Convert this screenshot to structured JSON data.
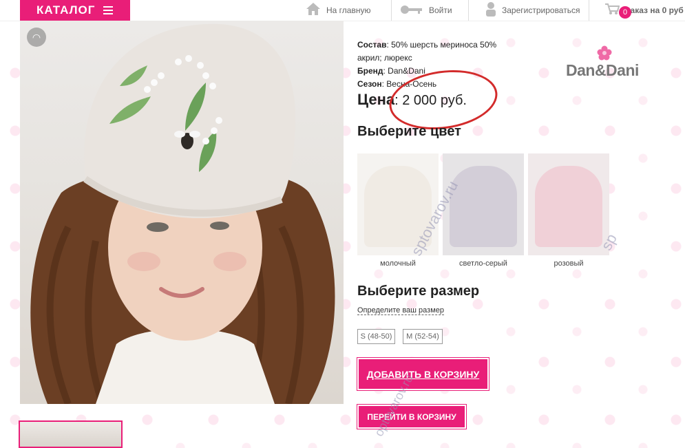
{
  "header": {
    "catalog_label": "КАТАЛОГ",
    "nav": {
      "home": "На главную",
      "login": "Войти",
      "register": "Зарегистрироваться",
      "cart_summary": "Заказ на 0 руб",
      "cart_count": "0"
    }
  },
  "product": {
    "composition_label": "Состав",
    "composition_value": ": 50% шерсть мериноса 50% акрил; люрекс",
    "brand_label": "Бренд",
    "brand_value": ": Dan&Dani",
    "season_label": "Сезон",
    "season_value": ": Весна-Осень",
    "price_label": "Цена",
    "price_value": ": 2 000 руб.",
    "brand_logo_text": "Dan&Dani"
  },
  "color_section": {
    "title": "Выберите цвет",
    "options": [
      {
        "label": "молочный",
        "color": "#f2ede6"
      },
      {
        "label": "светло-серый",
        "color": "#d6d1d9"
      },
      {
        "label": "розовый",
        "color": "#f1d4da"
      }
    ]
  },
  "size_section": {
    "title": "Выберите размер",
    "size_guide_link": "Определите ваш размер",
    "sizes": [
      "S (48-50)",
      "M (52-54)"
    ]
  },
  "actions": {
    "add_to_cart": "ДОБАВИТЬ В КОРЗИНУ",
    "go_to_cart": "ПЕРЕЙТИ В КОРЗИНУ"
  },
  "watermarks": [
    "sptovarov.ru",
    "sp",
    "optovarov.ru"
  ],
  "colors": {
    "accent": "#e91e78",
    "annotation": "#d32b2b"
  }
}
